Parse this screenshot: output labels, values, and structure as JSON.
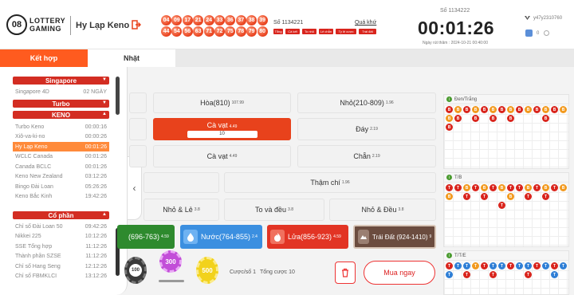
{
  "header": {
    "logo_number": "08",
    "logo_line1": "LOTTERY",
    "logo_line2": "GAMING",
    "game_title": "Hy Lạp Keno",
    "drawn_numbers": [
      "04",
      "09",
      "17",
      "21",
      "24",
      "33",
      "36",
      "37",
      "38",
      "39",
      "44",
      "54",
      "56",
      "63",
      "71",
      "72",
      "75",
      "78",
      "79",
      "80"
    ],
    "prev_draw_label": "Số 1134221",
    "past_link": "Quá khứ",
    "tags": [
      "Tổng",
      "Cả kết",
      "To nhỏ",
      "Lẻ chẵn",
      "Tỷ lệ cược",
      "Trái đất"
    ],
    "current_draw_label": "Số 1134222",
    "countdown": "00:01:26",
    "draw_time": "Ngày rút thăm : 2024-10-21 00:40:00",
    "username": "y47y2310760",
    "balance": "0"
  },
  "tabs": {
    "combined": "Kết hợp",
    "daily": "Nhặt"
  },
  "sidebar": {
    "section_singapore": "Singapore",
    "singapore_rows": [
      {
        "name": "Singapore 4D",
        "value": "02 NGÀY"
      }
    ],
    "section_turbo": "Turbo",
    "section_keno": "KENO",
    "keno_rows": [
      {
        "name": "Turbo Keno",
        "value": "00:00:16"
      },
      {
        "name": "Xiô-va-ki-no",
        "value": "00:00:26"
      },
      {
        "name": "Hy Lạp Keno",
        "value": "00:01:26"
      },
      {
        "name": "WCLC Canada",
        "value": "00:01:26"
      },
      {
        "name": "Canada BCLC",
        "value": "00:01:26"
      },
      {
        "name": "Keno New Zealand",
        "value": "03:12:26"
      },
      {
        "name": "Bingo Đài Loan",
        "value": "05:26:26"
      },
      {
        "name": "Keno Bắc Kinh",
        "value": "19:42:26"
      }
    ],
    "section_stock": "Cổ phần",
    "stock_rows": [
      {
        "name": "Chỉ số Đài Loan 50",
        "value": "09:42:26"
      },
      {
        "name": "Nikkei 225",
        "value": "10:12:26"
      },
      {
        "name": "SSE Tổng hợp",
        "value": "11:12:26"
      },
      {
        "name": "Thành phần SZSE",
        "value": "11:12:26"
      },
      {
        "name": "Chỉ số Hang Seng",
        "value": "12:12:26"
      },
      {
        "name": "Chỉ số FBMKLCI",
        "value": "13:12:26"
      }
    ]
  },
  "bets": {
    "hoa": {
      "label": "Hòa(810)",
      "odd": "107.99"
    },
    "nho": {
      "label": "Nhỏ(210-809)",
      "odd": "1.96"
    },
    "ca_vat_sel": {
      "label": "Cà vạt",
      "odd": "4.49",
      "input": "10"
    },
    "day": {
      "label": "Đáy",
      "odd": "2.19"
    },
    "ca_vat": {
      "label": "Cà vạt",
      "odd": "4.49"
    },
    "chan": {
      "label": "Chẵn",
      "odd": "2.19"
    },
    "tham_chi": {
      "label": "Thậm chí",
      "odd": "1.96"
    },
    "nho_le": {
      "label": "Nhỏ & Lẻ",
      "odd": "3.8"
    },
    "to_va_deu": {
      "label": "To và đều",
      "odd": "3.8"
    },
    "nho_deu": {
      "label": "Nhỏ & Đều",
      "odd": "3.8"
    },
    "kim": {
      "label": "(696-763)",
      "odd": "4.59"
    },
    "nuoc": {
      "label": "Nước(764-855)",
      "odd": "2.4"
    },
    "lua": {
      "label": "Lửa(856-923)",
      "odd": "4.59"
    },
    "trai_dat": {
      "label": "Trái Đất (924-1410)",
      "odd": "9"
    }
  },
  "chips": [
    "100",
    "300",
    "500"
  ],
  "summary": {
    "bet_count_label": "Cược/số",
    "bet_count": "1",
    "total_label": "Tổng cược",
    "total": "10"
  },
  "buy_label": "Mua ngay",
  "stats": {
    "panel1": "Đen/Trắng",
    "panel2": "T/B",
    "panel3": "T/T/E",
    "colors": {
      "red": "#d9251d",
      "orange": "#f29a1f",
      "blue": "#2f7fd6"
    }
  }
}
